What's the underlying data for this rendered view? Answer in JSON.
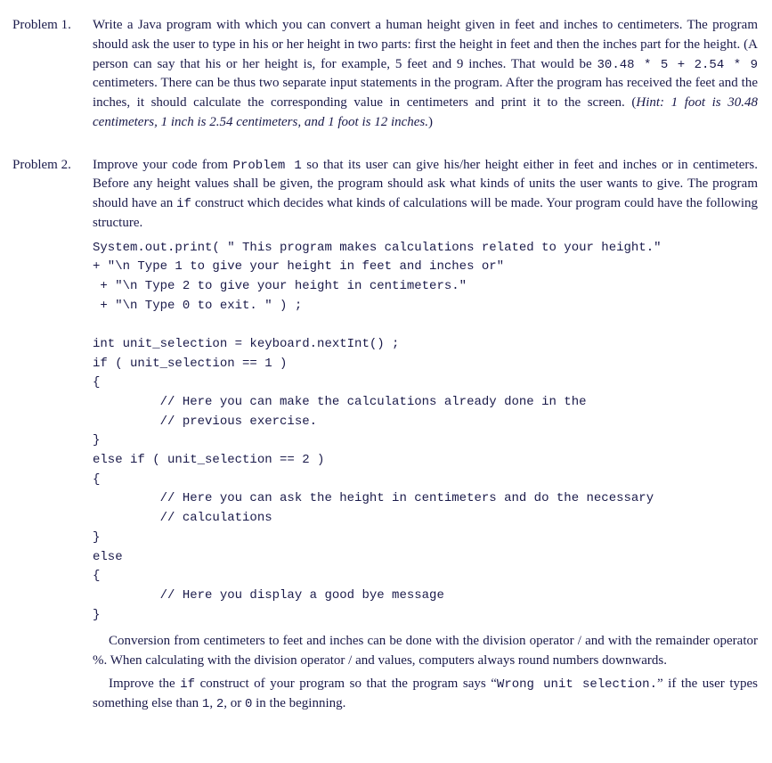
{
  "problems": [
    {
      "label": "Problem 1.",
      "body_parts": {
        "p1a": "Write a Java program with which you can convert a human height given in feet and inches to centimeters. The program should ask the user to type in his or her height in two parts: first the height in feet and then the inches part for the height. (A person can say that his or her height is, for example, 5 feet and 9 inches. That would be ",
        "p1_expr": "30.48 * 5 + 2.54 * 9",
        "p1b": " centimeters. There can be thus two separate input statements in the program. After the program has received the feet and the inches, it should calculate the corresponding value in centimeters and print it to the screen. (",
        "p1_hint_label": "Hint: ",
        "p1_hint_text": "1 foot is 30.48 centimeters, 1 inch is 2.54 centimeters, and 1 foot is 12 inches.",
        "p1c": ")"
      }
    },
    {
      "label": "Problem 2.",
      "body_parts": {
        "p1a": "Improve your code from ",
        "p1_ref": "Problem 1",
        "p1b": " so that its user can give his/her height either in feet and inches or in centimeters. Before any height values shall be given, the program should ask what kinds of units the user wants to give. The program should have an ",
        "p1_kw": "if",
        "p1c": " construct which decides what kinds of calculations will be made. Your program could have the following structure.",
        "code": "System.out.print( \" This program makes calculations related to your height.\"\n+ \"\\n Type 1 to give your height in feet and inches or\"\n + \"\\n Type 2 to give your height in centimeters.\"\n + \"\\n Type 0 to exit. \" ) ;\n\nint unit_selection = keyboard.nextInt() ;\nif ( unit_selection == 1 )\n{\n         // Here you can make the calculations already done in the\n         // previous exercise.\n}\nelse if ( unit_selection == 2 )\n{\n         // Here you can ask the height in centimeters and do the necessary\n         // calculations\n}\nelse\n{\n         // Here you display a good bye message\n}",
        "p2": "Conversion from centimeters to feet and inches can be done with the division operator / and with the remainder operator %. When calculating with the division operator / and values, computers always round numbers downwards.",
        "p3a": "Improve the ",
        "p3_kw": "if",
        "p3b": " construct of your program so that the program says “",
        "p3_msg": "Wrong unit selection.",
        "p3c": "” if the user types something else than ",
        "p3_v1": "1",
        "p3_s1": ", ",
        "p3_v2": "2",
        "p3_s2": ", or ",
        "p3_v3": "0",
        "p3d": " in the beginning."
      }
    }
  ]
}
